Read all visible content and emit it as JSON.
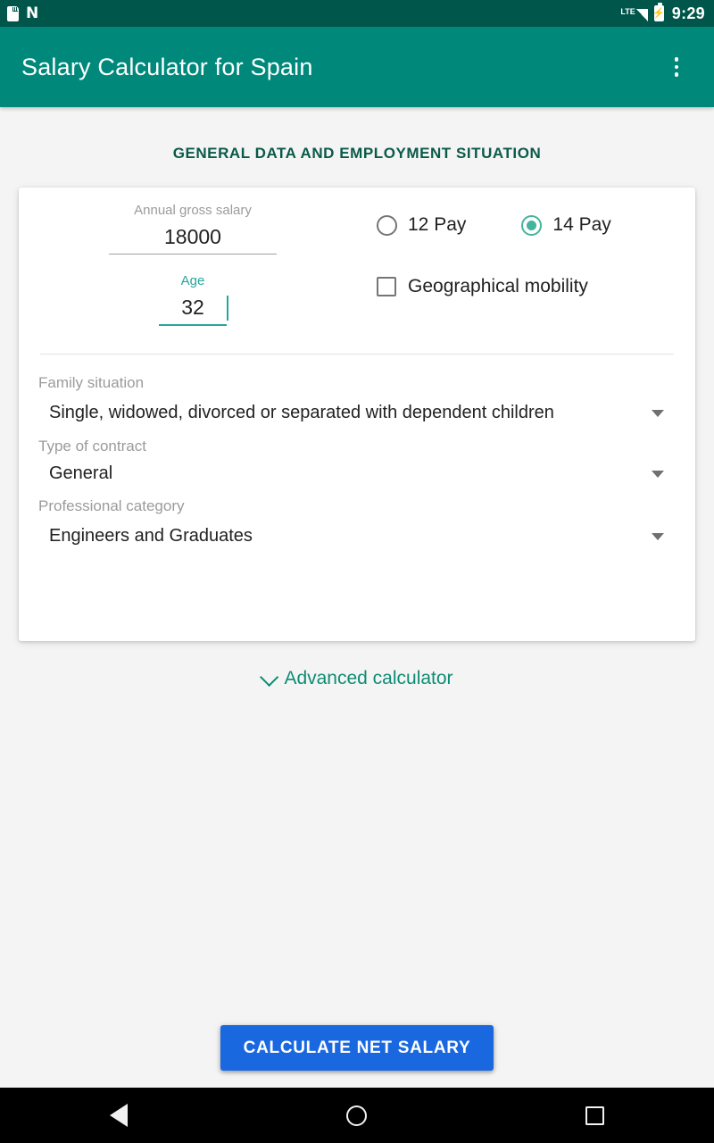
{
  "status_bar": {
    "time": "9:29",
    "lte_label": "LTE",
    "icons": [
      "sd-card-icon",
      "nfc-icon",
      "lte-signal-icon",
      "battery-charging-icon"
    ]
  },
  "app_bar": {
    "title": "Salary Calculator for Spain",
    "overflow_menu": "overflow-menu-icon",
    "background": "#00897b"
  },
  "section": {
    "heading": "GENERAL DATA AND EMPLOYMENT SITUATION",
    "heading_color": "#0a5a48"
  },
  "form": {
    "annual_gross_salary": {
      "label": "Annual gross salary",
      "value": "18000",
      "placeholder": "Annual gross salary",
      "focused": false
    },
    "age": {
      "label": "Age",
      "value": "32",
      "placeholder": "Age",
      "focused": true,
      "accent": "#26a69a"
    },
    "pay_options": {
      "selected": "14 Pay",
      "options": [
        {
          "label": "12 Pay",
          "selected": false
        },
        {
          "label": "14 Pay",
          "selected": true
        }
      ],
      "accent": "#45b39d"
    },
    "geographical_mobility": {
      "label": "Geographical mobility",
      "checked": false
    },
    "family_situation": {
      "label": "Family situation",
      "value": "Single, widowed, divorced or separated with dependent children"
    },
    "type_of_contract": {
      "label": "Type of contract",
      "value": "General"
    },
    "professional_category": {
      "label": "Professional category",
      "value": "Engineers and Graduates"
    }
  },
  "advanced": {
    "label": "Advanced calculator",
    "icon": "chevron-down-icon",
    "color": "#0d8c73"
  },
  "cta": {
    "label": "CALCULATE NET SALARY",
    "color": "#1a68e0"
  },
  "nav_bar": {
    "back": "back-triangle-icon",
    "home": "home-circle-icon",
    "recents": "recents-square-icon"
  }
}
